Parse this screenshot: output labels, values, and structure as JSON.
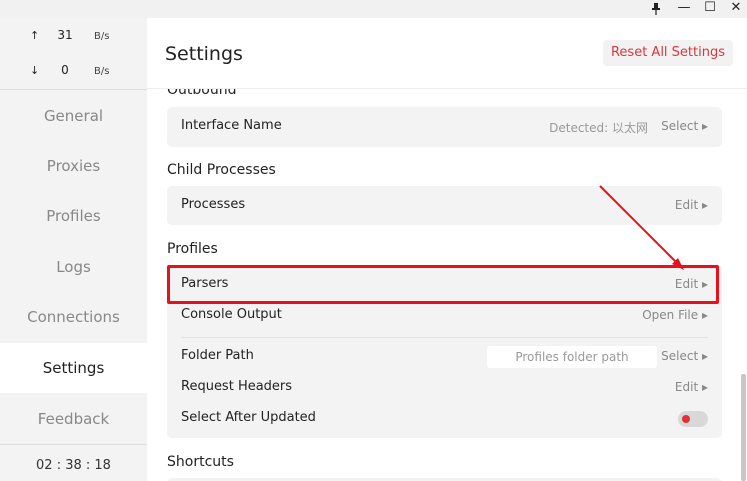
{
  "window": {
    "pin_icon": "pin-icon",
    "minimize": "—",
    "maximize": "☐",
    "close": "✕"
  },
  "sidebar": {
    "upload": {
      "arrow": "↑",
      "value": "31",
      "unit": "B/s"
    },
    "download": {
      "arrow": "↓",
      "value": "0",
      "unit": "B/s"
    },
    "items": [
      {
        "label": "General"
      },
      {
        "label": "Proxies"
      },
      {
        "label": "Profiles"
      },
      {
        "label": "Logs"
      },
      {
        "label": "Connections"
      },
      {
        "label": "Settings",
        "active": true
      },
      {
        "label": "Feedback"
      }
    ],
    "clock": "02 : 38 : 18"
  },
  "main": {
    "title": "Settings",
    "reset_label": "Reset All Settings",
    "outbound_title": "Outbound",
    "interface": {
      "label": "Interface Name",
      "detected": "Detected: 以太网",
      "action": "Select ▸"
    },
    "child_processes_title": "Child Processes",
    "processes": {
      "label": "Processes",
      "action": "Edit ▸"
    },
    "profiles_title": "Profiles",
    "profiles_rows": {
      "parsers": {
        "label": "Parsers",
        "action": "Edit ▸"
      },
      "console_output": {
        "label": "Console Output",
        "action": "Open File ▸"
      },
      "folder_path": {
        "label": "Folder Path",
        "placeholder": "Profiles folder path",
        "action": "Select ▸"
      },
      "request_headers": {
        "label": "Request Headers",
        "action": "Edit ▸"
      },
      "select_after_updated": {
        "label": "Select After Updated",
        "enabled": false
      }
    },
    "shortcuts_title": "Shortcuts"
  },
  "annotation_color": "#e8101a"
}
